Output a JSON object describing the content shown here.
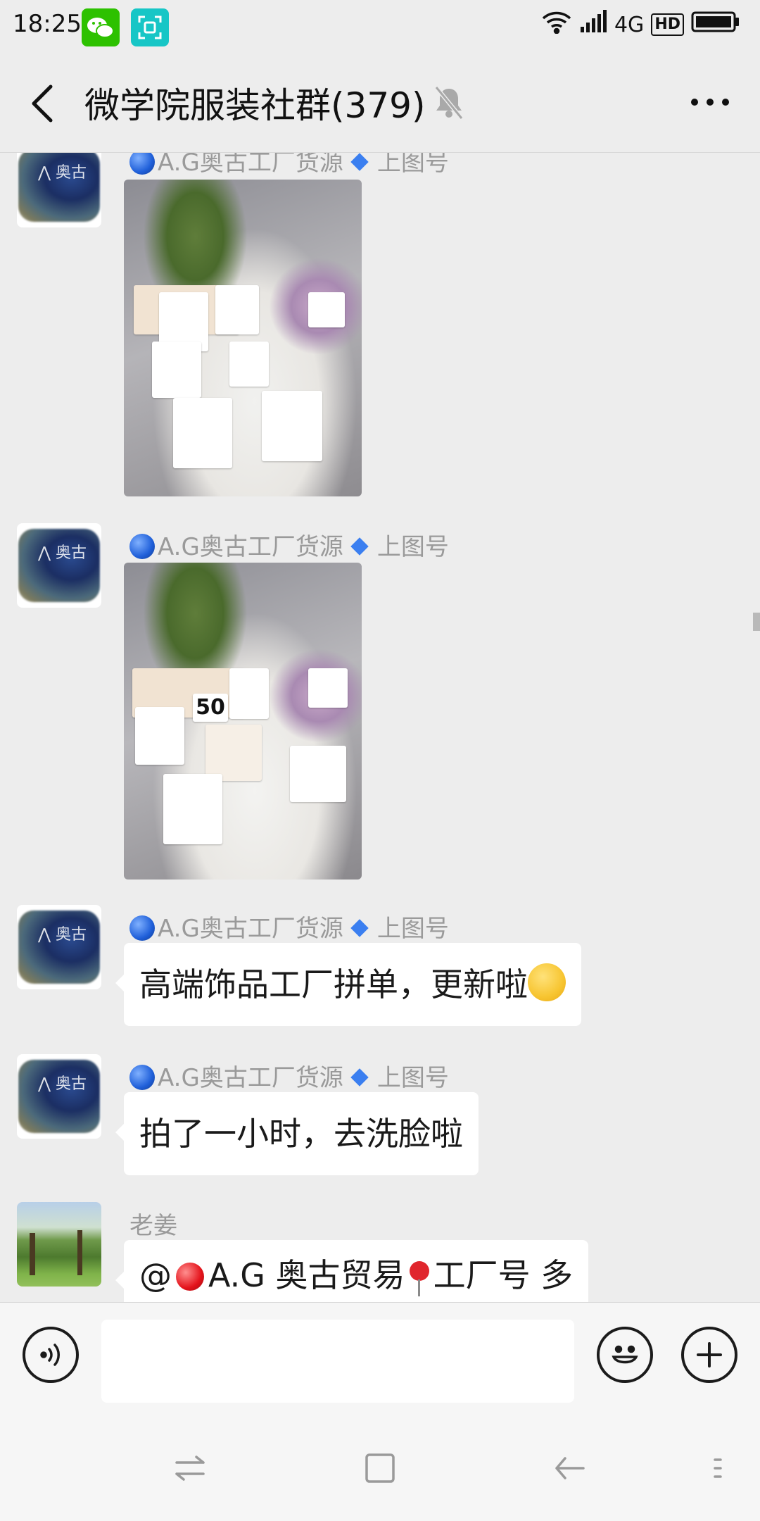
{
  "status_bar": {
    "time": "18:25",
    "network": "4G",
    "hd_badge": "HD",
    "icons": [
      "wechat-icon",
      "scan-icon",
      "wifi-icon",
      "signal-icon",
      "battery-icon"
    ]
  },
  "header": {
    "title": "微学院服装社群(379)",
    "icons": [
      "back-arrow-icon",
      "muted-bell-icon",
      "more-icon"
    ]
  },
  "messages": [
    {
      "sender": "A.G奥古工厂货源",
      "sender_suffix": "上图号",
      "type": "image",
      "avatar_text": "奥古"
    },
    {
      "sender": "A.G奥古工厂货源",
      "sender_suffix": "上图号",
      "type": "image",
      "avatar_text": "奥古",
      "photo_label": "50"
    },
    {
      "sender": "A.G奥古工厂货源",
      "sender_suffix": "上图号",
      "type": "text",
      "avatar_text": "奥古",
      "text": "高端饰品工厂拼单，更新啦"
    },
    {
      "sender": "A.G奥古工厂货源",
      "sender_suffix": "上图号",
      "type": "text",
      "avatar_text": "奥古",
      "text": "拍了一小时，去洗脸啦"
    },
    {
      "sender": "老姜",
      "type": "text",
      "text_prefix": "@",
      "text_a": "A.G 奥古贸易",
      "text_b": "工厂号  多"
    }
  ],
  "input_bar": {
    "placeholder": "",
    "icons": [
      "voice-icon",
      "emoji-icon",
      "plus-icon"
    ]
  },
  "nav_bar": {
    "icons": [
      "switch-icon",
      "home-square-icon",
      "back-icon",
      "menu-icon"
    ]
  }
}
